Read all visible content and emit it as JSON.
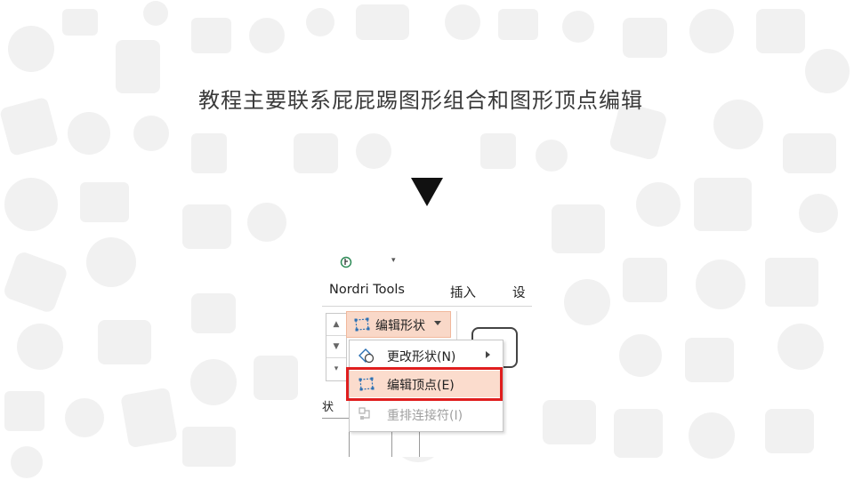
{
  "title": "教程主要联系屁屁踢图形组合和图形顶点编辑",
  "icons": {
    "pointer": "down-pointer-triangle-icon",
    "background": "doodle-pattern-background"
  },
  "quick_access": {
    "icon": "touch-mode-icon",
    "caret": "▾"
  },
  "ribbon": {
    "tabs": [
      {
        "label": "Nordri Tools"
      },
      {
        "label": "插入"
      },
      {
        "label": "设"
      }
    ],
    "edit_shape_button": {
      "label": "编辑形状",
      "icon": "edit-points-icon"
    },
    "gallery_buttons": [
      "▲",
      "▼",
      "▾"
    ],
    "side_label": "状"
  },
  "menu": {
    "items": [
      {
        "label": "更改形状(N)",
        "icon": "change-shape-icon",
        "submenu": true,
        "enabled": true,
        "highlighted": false
      },
      {
        "label": "编辑顶点(E)",
        "icon": "edit-points-icon",
        "submenu": false,
        "enabled": true,
        "highlighted": true
      },
      {
        "label": "重排连接符(I)",
        "icon": "reroute-connectors-icon",
        "submenu": false,
        "enabled": false,
        "highlighted": false
      }
    ]
  },
  "colors": {
    "highlight_fill": "#fbdccd",
    "highlight_border": "#e01e1e",
    "title_text": "#3a3a3a"
  }
}
